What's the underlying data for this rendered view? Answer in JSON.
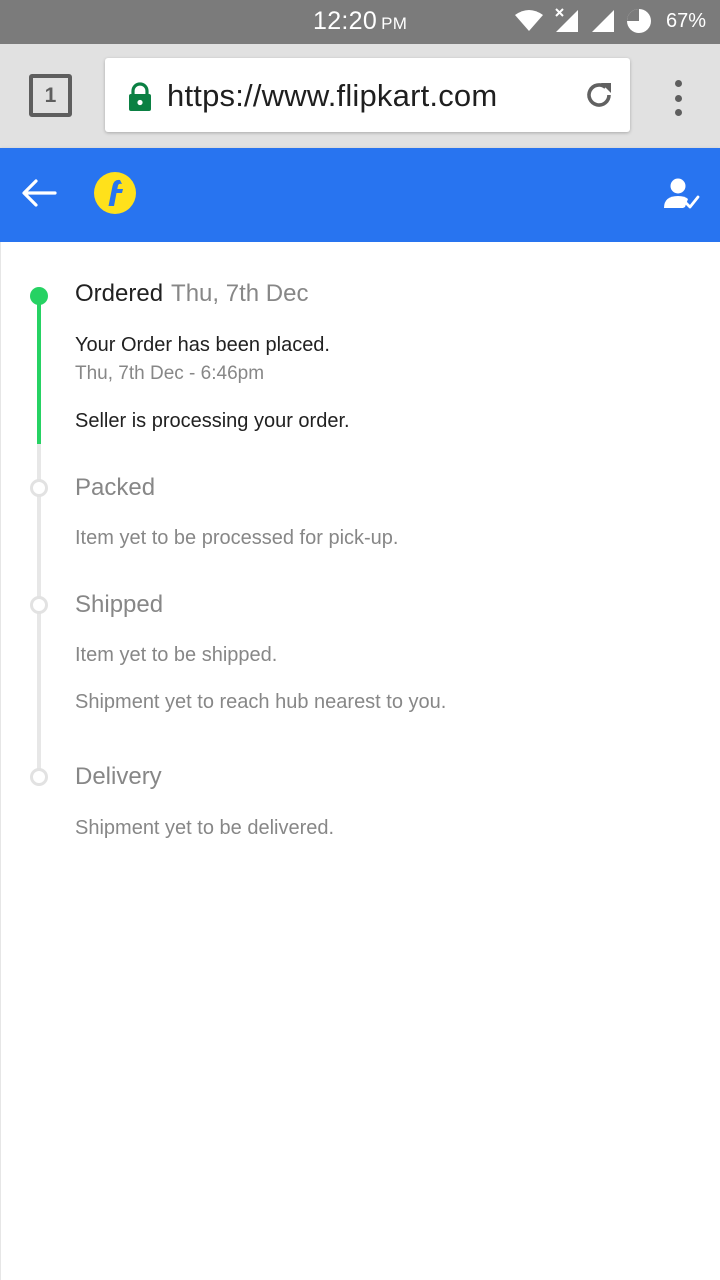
{
  "status_bar": {
    "time": "12:20",
    "ampm": "PM",
    "battery": "67%"
  },
  "browser": {
    "tab_count": "1",
    "url": "https://www.flipkart.com"
  },
  "header": {
    "colors": {
      "bar": "#2874f0",
      "logo": "#ffe11b"
    }
  },
  "tracking": {
    "colors": {
      "done": "#26d263",
      "pending": "#e2e2e2"
    },
    "ordered": {
      "title": "Ordered",
      "date": "Thu, 7th Dec",
      "lines": [
        "Your Order has been placed.",
        "Thu, 7th Dec - 6:46pm",
        "Seller is processing your order."
      ]
    },
    "packed": {
      "title": "Packed",
      "lines": [
        "Item yet to be processed for pick-up."
      ]
    },
    "shipped": {
      "title": "Shipped",
      "lines": [
        "Item yet to be shipped.",
        "Shipment yet to reach hub nearest to you."
      ]
    },
    "delivery": {
      "title": "Delivery",
      "lines": [
        "Shipment yet to be delivered."
      ]
    }
  },
  "icons": {
    "back": "arrow-left",
    "logo": "flipkart-logo",
    "account": "account-verified",
    "lock": "lock",
    "reload": "reload",
    "menu": "more-vertical"
  }
}
